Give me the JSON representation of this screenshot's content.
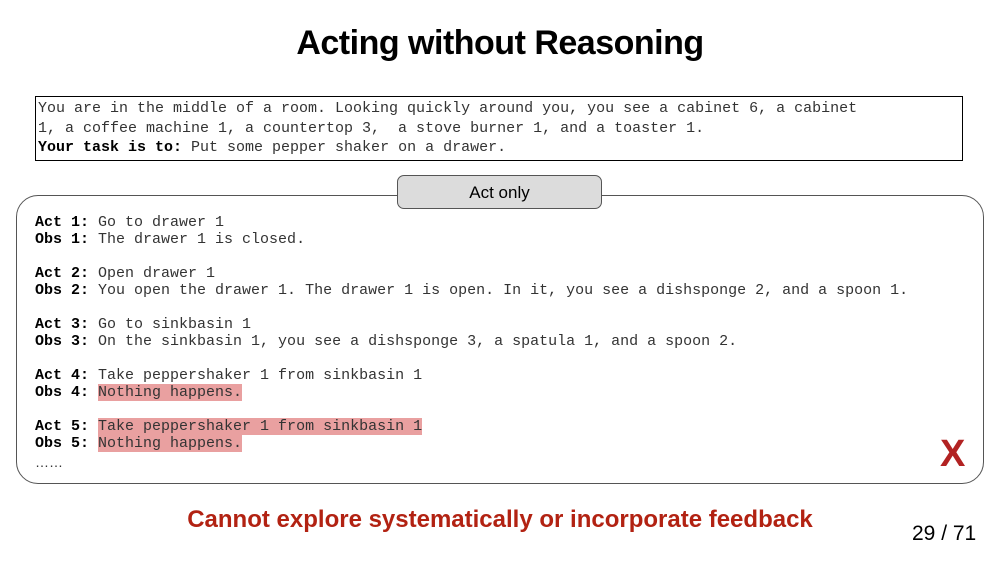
{
  "slide": {
    "title": "Acting without Reasoning",
    "task": {
      "line1": "You are in the middle of a room. Looking quickly around you, you see a cabinet 6, a cabinet",
      "line2": "1, a coffee machine 1, a countertop 3,  a stove burner 1, and a toaster 1.",
      "task_label": "Your task is to:",
      "task_text": " Put some pepper shaker on a drawer."
    },
    "panel_label": "Act only",
    "steps": [
      {
        "act_label": "Act 1:",
        "act": "Go to drawer 1",
        "obs_label": "Obs 1:",
        "obs": "The drawer 1 is closed."
      },
      {
        "act_label": "Act 2:",
        "act": "Open drawer 1",
        "obs_label": "Obs 2:",
        "obs": "You open the drawer 1. The drawer 1 is open. In it, you see a dishsponge 2, and a spoon 1."
      },
      {
        "act_label": "Act 3:",
        "act": "Go to sinkbasin 1",
        "obs_label": "Obs 3:",
        "obs": "On the sinkbasin 1, you see a dishsponge 3, a spatula 1, and a spoon 2."
      },
      {
        "act_label": "Act 4:",
        "act": "Take peppershaker 1 from sinkbasin 1",
        "obs_label": "Obs 4:",
        "obs": "Nothing happens."
      },
      {
        "act_label": "Act 5:",
        "act": "Take peppershaker 1 from sinkbasin 1",
        "obs_label": "Obs 5:",
        "obs": "Nothing happens."
      }
    ],
    "ellipsis": "……",
    "fail_mark": "X",
    "bottom_note": "Cannot explore systematically or incorporate feedback",
    "page_number": "29 / 71",
    "colors": {
      "highlight": "#e9a0a0",
      "accent_red": "#b22212",
      "panel_header_bg": "#dcdcdc"
    }
  }
}
